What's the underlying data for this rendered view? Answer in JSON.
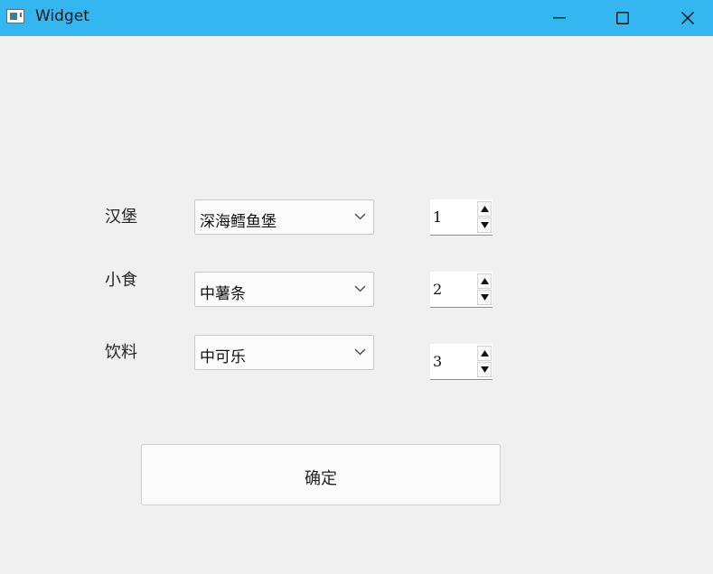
{
  "window": {
    "title": "Widget",
    "titlebar_color": "#34b6f1",
    "icons": {
      "app": "window-icon",
      "minimize": "minimize-icon",
      "maximize": "maximize-icon",
      "close": "close-icon"
    }
  },
  "form": {
    "rows": [
      {
        "label": "汉堡",
        "selected": "深海鳕鱼堡",
        "quantity": "1"
      },
      {
        "label": "小食",
        "selected": "中薯条",
        "quantity": "2"
      },
      {
        "label": "饮料",
        "selected": "中可乐",
        "quantity": "3"
      }
    ],
    "confirm_label": "确定"
  }
}
